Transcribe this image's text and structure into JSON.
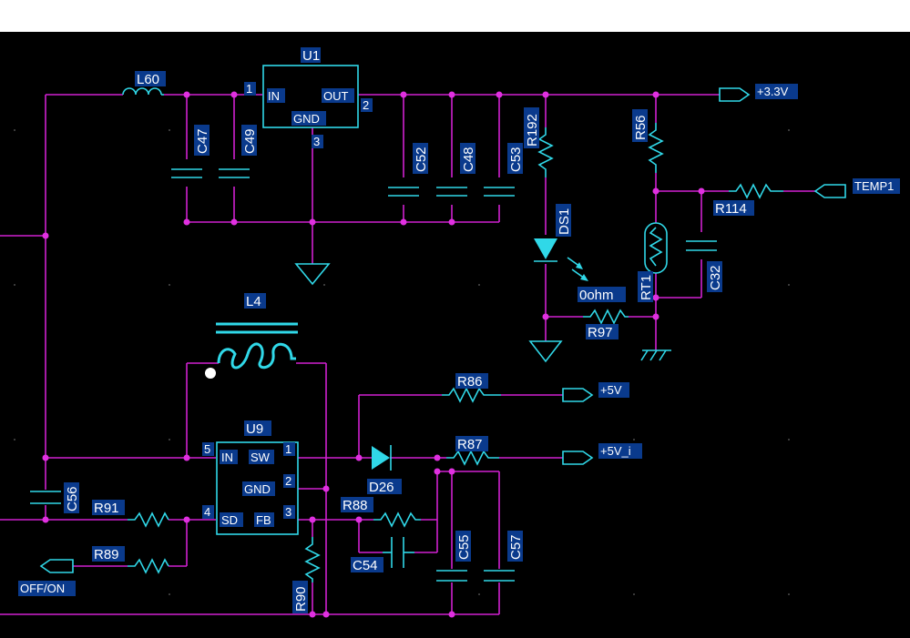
{
  "colors": {
    "background": "#000000",
    "wire": "#d020d0",
    "component": "#30d8e8",
    "label_box": "#0a3a8c",
    "label_text": "#ffffff",
    "junction": "#e030e0"
  },
  "designators": {
    "U1": "U1",
    "U9": "U9",
    "L60": "L60",
    "L4": "L4",
    "C47": "C47",
    "C49": "C49",
    "C52": "C52",
    "C48": "C48",
    "C53": "C53",
    "C32": "C32",
    "C56": "C56",
    "C54": "C54",
    "C55": "C55",
    "C57": "C57",
    "R192": "R192",
    "R56": "R56",
    "R114": "R114",
    "R97": "R97",
    "R86": "R86",
    "R87": "R87",
    "R88": "R88",
    "R91": "R91",
    "R89": "R89",
    "R90": "R90",
    "RT1": "RT1",
    "DS1": "DS1",
    "D26": "D26"
  },
  "values": {
    "r97_value": "0ohm"
  },
  "u1": {
    "pins": {
      "p1": "1",
      "p2": "2",
      "p3": "3"
    },
    "pin_names": {
      "in": "IN",
      "out": "OUT",
      "gnd": "GND"
    }
  },
  "u9": {
    "pins": {
      "p1": "1",
      "p2": "2",
      "p3": "3",
      "p4": "4",
      "p5": "5"
    },
    "pin_names": {
      "in": "IN",
      "sw": "SW",
      "gnd": "GND",
      "sd": "SD",
      "fb": "FB"
    }
  },
  "nets": {
    "v33": "+3.3V",
    "temp1": "TEMP1",
    "v5": "+5V",
    "v5i": "+5V_i",
    "offon": "OFF/ON"
  }
}
